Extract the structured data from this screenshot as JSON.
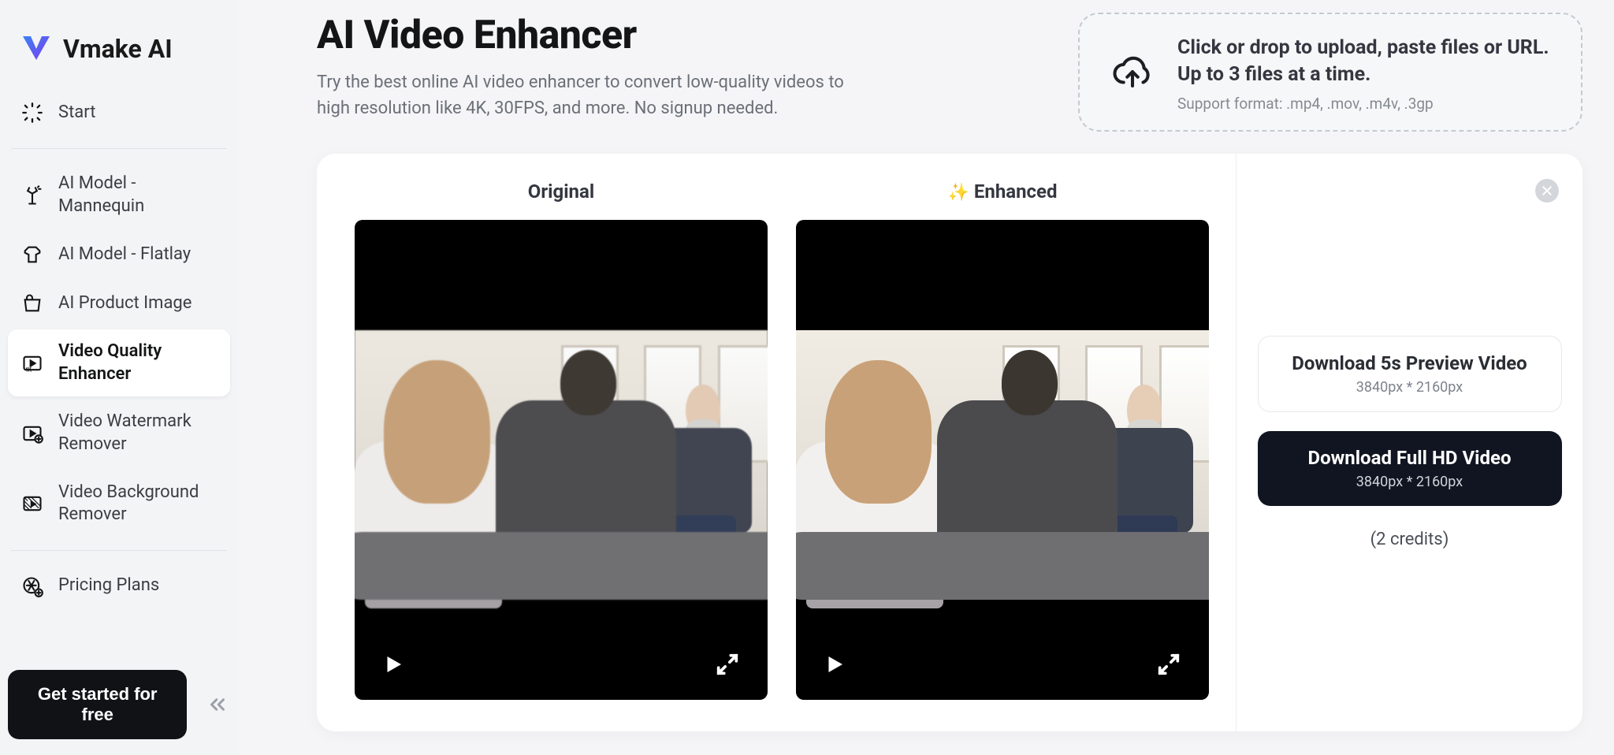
{
  "brand": {
    "name": "Vmake AI"
  },
  "sidebar": {
    "start": "Start",
    "items": [
      {
        "label": "AI Model - Mannequin"
      },
      {
        "label": "AI Model - Flatlay"
      },
      {
        "label": "AI Product Image"
      },
      {
        "label": "Video Quality Enhancer"
      },
      {
        "label": "Video Watermark Remover"
      },
      {
        "label": "Video Background Remover"
      }
    ],
    "pricing": "Pricing Plans",
    "cta": "Get started for free"
  },
  "page": {
    "title": "AI Video Enhancer",
    "desc": "Try the best online AI video enhancer to convert low-quality videos to high resolution like 4K, 30FPS, and more. No signup needed."
  },
  "upload": {
    "line1": "Click or drop to upload, paste files or URL.",
    "line2": "Up to 3 files at a time.",
    "support": "Support format: .mp4, .mov, .m4v, .3gp"
  },
  "compare": {
    "original_label": "Original",
    "enhanced_label": "Enhanced"
  },
  "download": {
    "preview_title": "Download 5s Preview Video",
    "preview_res": "3840px * 2160px",
    "full_title": "Download Full HD Video",
    "full_res": "3840px * 2160px",
    "credits": "(2 credits)"
  }
}
